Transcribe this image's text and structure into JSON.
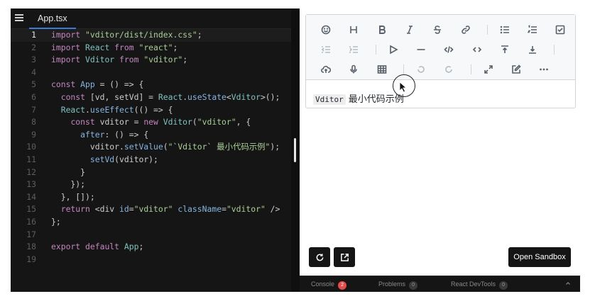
{
  "editor": {
    "tab": "App.tsx",
    "lines": [
      [
        [
          "kw",
          "import"
        ],
        [
          "pl",
          " "
        ],
        [
          "st",
          "\"vditor/dist/index.css\""
        ],
        [
          "pl",
          ";"
        ]
      ],
      [
        [
          "kw",
          "import"
        ],
        [
          "pl",
          " "
        ],
        [
          "ty",
          "React"
        ],
        [
          "pl",
          " "
        ],
        [
          "kw",
          "from"
        ],
        [
          "pl",
          " "
        ],
        [
          "st",
          "\"react\""
        ],
        [
          "pl",
          ";"
        ]
      ],
      [
        [
          "kw",
          "import"
        ],
        [
          "pl",
          " "
        ],
        [
          "ty",
          "Vditor"
        ],
        [
          "pl",
          " "
        ],
        [
          "kw",
          "from"
        ],
        [
          "pl",
          " "
        ],
        [
          "st",
          "\"vditor\""
        ],
        [
          "pl",
          ";"
        ]
      ],
      [],
      [
        [
          "kw",
          "const"
        ],
        [
          "pl",
          " "
        ],
        [
          "fn",
          "App"
        ],
        [
          "pl",
          " = () => {"
        ]
      ],
      [
        [
          "pl",
          "  "
        ],
        [
          "kw",
          "const"
        ],
        [
          "pl",
          " [vd, setVd] = "
        ],
        [
          "ty",
          "React"
        ],
        [
          "pl",
          "."
        ],
        [
          "fn",
          "useState"
        ],
        [
          "pl",
          "<"
        ],
        [
          "ty",
          "Vditor"
        ],
        [
          "pl",
          ">();"
        ]
      ],
      [
        [
          "pl",
          "  "
        ],
        [
          "ty",
          "React"
        ],
        [
          "pl",
          "."
        ],
        [
          "fn",
          "useEffect"
        ],
        [
          "pl",
          "(() => {"
        ]
      ],
      [
        [
          "pl",
          "    "
        ],
        [
          "kw",
          "const"
        ],
        [
          "pl",
          " vditor = "
        ],
        [
          "kw",
          "new"
        ],
        [
          "pl",
          " "
        ],
        [
          "ty",
          "Vditor"
        ],
        [
          "pl",
          "("
        ],
        [
          "st",
          "\"vditor\""
        ],
        [
          "pl",
          ", {"
        ]
      ],
      [
        [
          "pl",
          "      "
        ],
        [
          "fn",
          "after"
        ],
        [
          "pl",
          ": () => {"
        ]
      ],
      [
        [
          "pl",
          "        vditor."
        ],
        [
          "fn",
          "setValue"
        ],
        [
          "pl",
          "("
        ],
        [
          "st",
          "\"`Vditor` 最小代码示例\""
        ],
        [
          "pl",
          ");"
        ]
      ],
      [
        [
          "pl",
          "        "
        ],
        [
          "fn",
          "setVd"
        ],
        [
          "pl",
          "(vditor);"
        ]
      ],
      [
        [
          "pl",
          "      }"
        ]
      ],
      [
        [
          "pl",
          "    });"
        ]
      ],
      [
        [
          "pl",
          "  }, []);"
        ]
      ],
      [
        [
          "pl",
          "  "
        ],
        [
          "kw",
          "return"
        ],
        [
          "pl",
          " <div "
        ],
        [
          "fn",
          "id"
        ],
        [
          "pl",
          "="
        ],
        [
          "st",
          "\"vditor\""
        ],
        [
          "pl",
          " "
        ],
        [
          "fn",
          "className"
        ],
        [
          "pl",
          "="
        ],
        [
          "st",
          "\"vditor\""
        ],
        [
          "pl",
          " />"
        ]
      ],
      [
        [
          "pl",
          "};"
        ]
      ],
      [],
      [
        [
          "kw",
          "export"
        ],
        [
          "pl",
          " "
        ],
        [
          "kw",
          "default"
        ],
        [
          "pl",
          " "
        ],
        [
          "ty",
          "App"
        ],
        [
          "pl",
          ";"
        ]
      ],
      []
    ],
    "active_line": 1
  },
  "toolbar": {
    "rows": [
      [
        "emoji-icon",
        "heading-icon",
        "bold-icon",
        "italic-icon",
        "strike-icon",
        "link-icon",
        "|",
        "list-icon",
        "ordered-list-icon",
        "check-icon"
      ],
      [
        "outdent-icon",
        "indent-icon",
        "|",
        "quote-icon",
        "line-icon",
        "code-icon",
        "inline-code-icon",
        "insert-before-icon",
        "insert-after-icon",
        "|"
      ],
      [
        "upload-icon",
        "record-icon",
        "table-icon",
        "|",
        "undo-icon",
        "redo-icon",
        "|",
        "fullscreen-icon",
        "edit-mode-icon",
        "more-icon"
      ]
    ]
  },
  "vditor": {
    "code_text": "Vditor",
    "text": "最小代码示例"
  },
  "preview": {
    "open_label": "Open Sandbox",
    "refresh_icon": "refresh-icon",
    "open_new_icon": "open-new-window-icon"
  },
  "devtools": {
    "tabs": [
      {
        "label": "Console",
        "count": "2",
        "color": "#e34c4c"
      },
      {
        "label": "Problems",
        "count": "0",
        "color": "#3a3a3a"
      },
      {
        "label": "React DevTools",
        "count": "0",
        "color": "#3a3a3a"
      }
    ]
  }
}
